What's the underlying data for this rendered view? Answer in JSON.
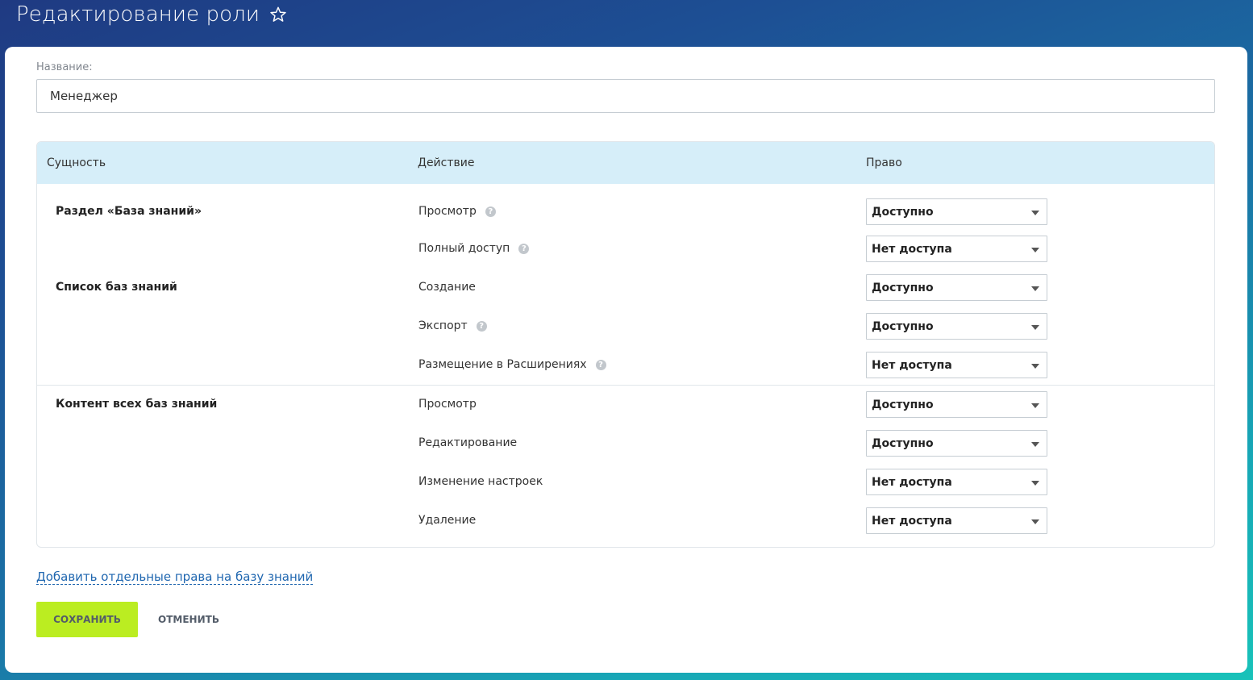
{
  "header": {
    "title": "Редактирование роли",
    "star_icon": "star-outline-icon"
  },
  "form": {
    "name_label": "Название:",
    "name_value": "Менеджер"
  },
  "table": {
    "columns": [
      "Сущность",
      "Действие",
      "Право"
    ],
    "rows": [
      {
        "entity": "Раздел «База знаний»",
        "action": "Просмотр",
        "help": true,
        "value": "Доступно"
      },
      {
        "entity": "",
        "action": "Полный доступ",
        "help": true,
        "value": "Нет доступа"
      },
      {
        "entity": "Список баз знаний",
        "action": "Создание",
        "help": false,
        "value": "Доступно"
      },
      {
        "entity": "",
        "action": "Экспорт",
        "help": true,
        "value": "Доступно"
      },
      {
        "entity": "",
        "action": "Размещение в Расширениях",
        "help": true,
        "value": "Нет доступа"
      },
      {
        "entity": "Контент всех баз знаний",
        "action": "Просмотр",
        "help": false,
        "value": "Доступно"
      },
      {
        "entity": "",
        "action": "Редактирование",
        "help": false,
        "value": "Доступно"
      },
      {
        "entity": "",
        "action": "Изменение настроек",
        "help": false,
        "value": "Нет доступа"
      },
      {
        "entity": "",
        "action": "Удаление",
        "help": false,
        "value": "Нет доступа"
      }
    ]
  },
  "help_icon_glyph": "?",
  "links": {
    "add_rights": "Добавить отдельные права на базу знаний"
  },
  "buttons": {
    "save": "СОХРАНИТЬ",
    "cancel": "ОТМЕНИТЬ"
  },
  "colors": {
    "accent_green": "#bbed21",
    "link_blue": "#2067b0",
    "table_header_bg": "#d6eef9"
  }
}
